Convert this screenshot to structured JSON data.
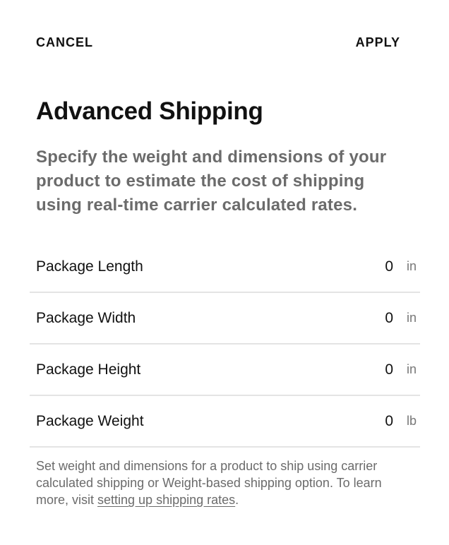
{
  "toolbar": {
    "cancel_label": "CANCEL",
    "apply_label": "APPLY"
  },
  "header": {
    "title": "Advanced Shipping",
    "description": "Specify the weight and dimensions of your product to estimate the cost of shipping using real-time carrier calculated rates."
  },
  "fields": [
    {
      "label": "Package Length",
      "value": "0",
      "unit": "in"
    },
    {
      "label": "Package Width",
      "value": "0",
      "unit": "in"
    },
    {
      "label": "Package Height",
      "value": "0",
      "unit": "in"
    },
    {
      "label": "Package Weight",
      "value": "0",
      "unit": "lb"
    }
  ],
  "footnote": {
    "text": "Set weight and dimensions for a product to ship using carrier calculated shipping or Weight-based shipping option. To learn more, visit ",
    "link_label": "setting up shipping rates",
    "trailing": "."
  }
}
